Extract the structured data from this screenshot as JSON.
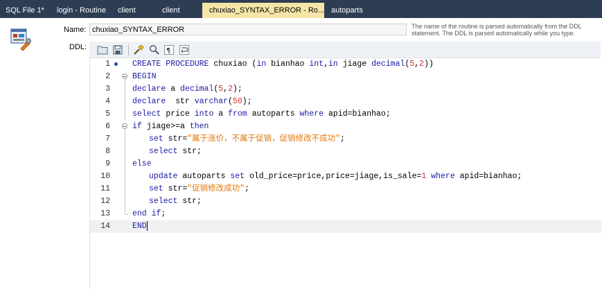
{
  "tabs": [
    {
      "label": "SQL File 1*"
    },
    {
      "label": "login - Routine"
    },
    {
      "label": "client"
    },
    {
      "label": "client"
    },
    {
      "label": "chuxiao_SYNTAX_ERROR - Ro...",
      "active": true
    },
    {
      "label": "autoparts"
    }
  ],
  "tab_close_glyph": "×",
  "form": {
    "name_label": "Name:",
    "name_value": "chuxiao_SYNTAX_ERROR",
    "ddl_label": "DDL:",
    "hint": "The name of the routine is parsed automatically from the DDL statement. The DDL is parsed automatically while you type."
  },
  "toolbar_icons": [
    "open-folder-icon",
    "save-icon",
    "beautify-icon",
    "find-icon",
    "invisible-chars-icon",
    "wrap-icon"
  ],
  "editor": {
    "lines": [
      {
        "n": "1",
        "indent": 0,
        "marker": true,
        "fold": "none",
        "tokens": [
          [
            "kw",
            "CREATE PROCEDURE"
          ],
          [
            "t",
            " chuxiao ("
          ],
          [
            "kw",
            "in"
          ],
          [
            "t",
            " bianhao "
          ],
          [
            "kw",
            "int"
          ],
          [
            "t",
            ","
          ],
          [
            "kw",
            "in"
          ],
          [
            "t",
            " jiage "
          ],
          [
            "kw",
            "decimal"
          ],
          [
            "t",
            "("
          ],
          [
            "num",
            "5"
          ],
          [
            "t",
            ","
          ],
          [
            "num",
            "2"
          ],
          [
            "t",
            "))"
          ]
        ]
      },
      {
        "n": "2",
        "indent": 0,
        "fold": "open",
        "tokens": [
          [
            "kw",
            "BEGIN"
          ]
        ]
      },
      {
        "n": "3",
        "indent": 0,
        "fold": "line",
        "tokens": [
          [
            "kw",
            "declare"
          ],
          [
            "t",
            " a "
          ],
          [
            "kw",
            "decimal"
          ],
          [
            "t",
            "("
          ],
          [
            "num",
            "5"
          ],
          [
            "t",
            ","
          ],
          [
            "num",
            "2"
          ],
          [
            "t",
            ");"
          ]
        ]
      },
      {
        "n": "4",
        "indent": 0,
        "fold": "line",
        "tokens": [
          [
            "kw",
            "declare"
          ],
          [
            "t",
            "  str "
          ],
          [
            "kw",
            "varchar"
          ],
          [
            "t",
            "("
          ],
          [
            "num",
            "50"
          ],
          [
            "t",
            ");"
          ]
        ]
      },
      {
        "n": "5",
        "indent": 0,
        "fold": "line",
        "tokens": [
          [
            "kw",
            "select"
          ],
          [
            "t",
            " price "
          ],
          [
            "kw",
            "into"
          ],
          [
            "t",
            " a "
          ],
          [
            "kw",
            "from"
          ],
          [
            "t",
            " autoparts "
          ],
          [
            "kw",
            "where"
          ],
          [
            "t",
            " apid=bianhao;"
          ]
        ]
      },
      {
        "n": "6",
        "indent": 0,
        "fold": "open",
        "tokens": [
          [
            "kw",
            "if"
          ],
          [
            "t",
            " jiage>=a "
          ],
          [
            "kw",
            "then"
          ]
        ]
      },
      {
        "n": "7",
        "indent": 1,
        "fold": "line",
        "tokens": [
          [
            "kw",
            "set"
          ],
          [
            "t",
            " str="
          ],
          [
            "str",
            "\"属于涨价，不属于促销，促销修改不成功\""
          ],
          [
            "t",
            ";"
          ]
        ]
      },
      {
        "n": "8",
        "indent": 1,
        "fold": "line",
        "tokens": [
          [
            "kw",
            "select"
          ],
          [
            "t",
            " str;"
          ]
        ]
      },
      {
        "n": "9",
        "indent": 0,
        "fold": "line",
        "tokens": [
          [
            "kw",
            "else"
          ]
        ]
      },
      {
        "n": "10",
        "indent": 1,
        "fold": "line",
        "tokens": [
          [
            "kw",
            "update"
          ],
          [
            "t",
            " autoparts "
          ],
          [
            "kw",
            "set"
          ],
          [
            "t",
            " old_price=price,price=jiage,is_sale="
          ],
          [
            "num",
            "1"
          ],
          [
            "t",
            " "
          ],
          [
            "kw",
            "where"
          ],
          [
            "t",
            " apid=bianhao;"
          ]
        ]
      },
      {
        "n": "11",
        "indent": 1,
        "fold": "line",
        "tokens": [
          [
            "kw",
            "set"
          ],
          [
            "t",
            " str="
          ],
          [
            "str",
            "\"促销修改成功\""
          ],
          [
            "t",
            ";"
          ]
        ]
      },
      {
        "n": "12",
        "indent": 1,
        "fold": "line",
        "tokens": [
          [
            "kw",
            "select"
          ],
          [
            "t",
            " str;"
          ]
        ]
      },
      {
        "n": "13",
        "indent": 0,
        "fold": "end",
        "tokens": [
          [
            "kw",
            "end"
          ],
          [
            "t",
            " "
          ],
          [
            "kw",
            "if"
          ],
          [
            "t",
            ";"
          ]
        ]
      },
      {
        "n": "14",
        "indent": 0,
        "fold": "none",
        "current": true,
        "caret": true,
        "tokens": [
          [
            "kw",
            "END"
          ]
        ]
      }
    ]
  },
  "colors": {
    "keyword": "#1a1aa6",
    "number": "#d6302a",
    "string": "#e07a10",
    "tabbar": "#2d3e54",
    "active_tab": "#f5e6a8"
  }
}
